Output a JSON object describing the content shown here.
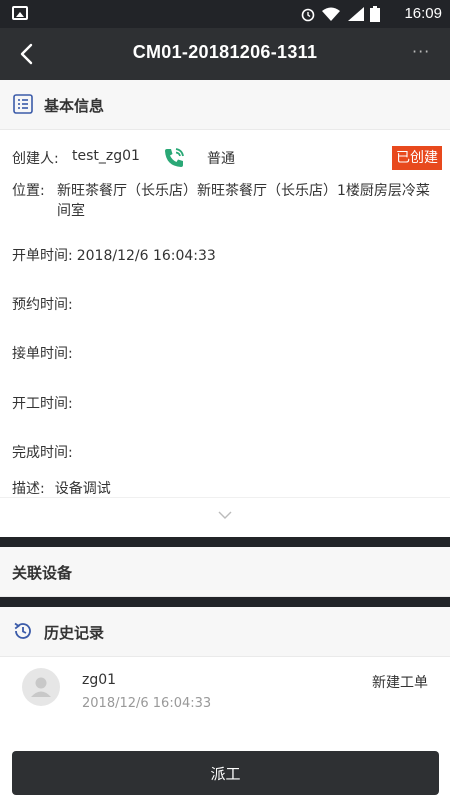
{
  "status_bar": {
    "time": "16:09",
    "icons": [
      "image-icon",
      "alarm-icon",
      "wifi-icon",
      "signal-icon",
      "battery-icon"
    ]
  },
  "nav": {
    "title": "CM01-20181206-1311",
    "more": "···"
  },
  "basic_info": {
    "title": "基本信息",
    "creator_label": "创建人:",
    "creator_value": "test_zg01",
    "priority": "普通",
    "status": "已创建",
    "location_label": "位置:",
    "location_value": "新旺茶餐厅（长乐店）新旺茶餐厅（长乐店）1楼厨房层冷菜间室",
    "open_time_label": "开单时间:",
    "open_time_value": "2018/12/6 16:04:33",
    "reserve_time_label": "预约时间:",
    "accept_time_label": "接单时间:",
    "start_time_label": "开工时间:",
    "complete_time_label": "完成时间:",
    "desc_label": "描述:",
    "desc_value": "设备调试"
  },
  "related_devices": {
    "title": "关联设备"
  },
  "history": {
    "title": "历史记录",
    "items": [
      {
        "user": "zg01",
        "action": "新建工单",
        "timestamp": "2018/12/6 16:04:33"
      }
    ]
  },
  "footer": {
    "dispatch_label": "派工"
  },
  "colors": {
    "nav_bg": "#2e3033",
    "status_badge": "#e8491d",
    "phone_green": "#2aa876"
  }
}
